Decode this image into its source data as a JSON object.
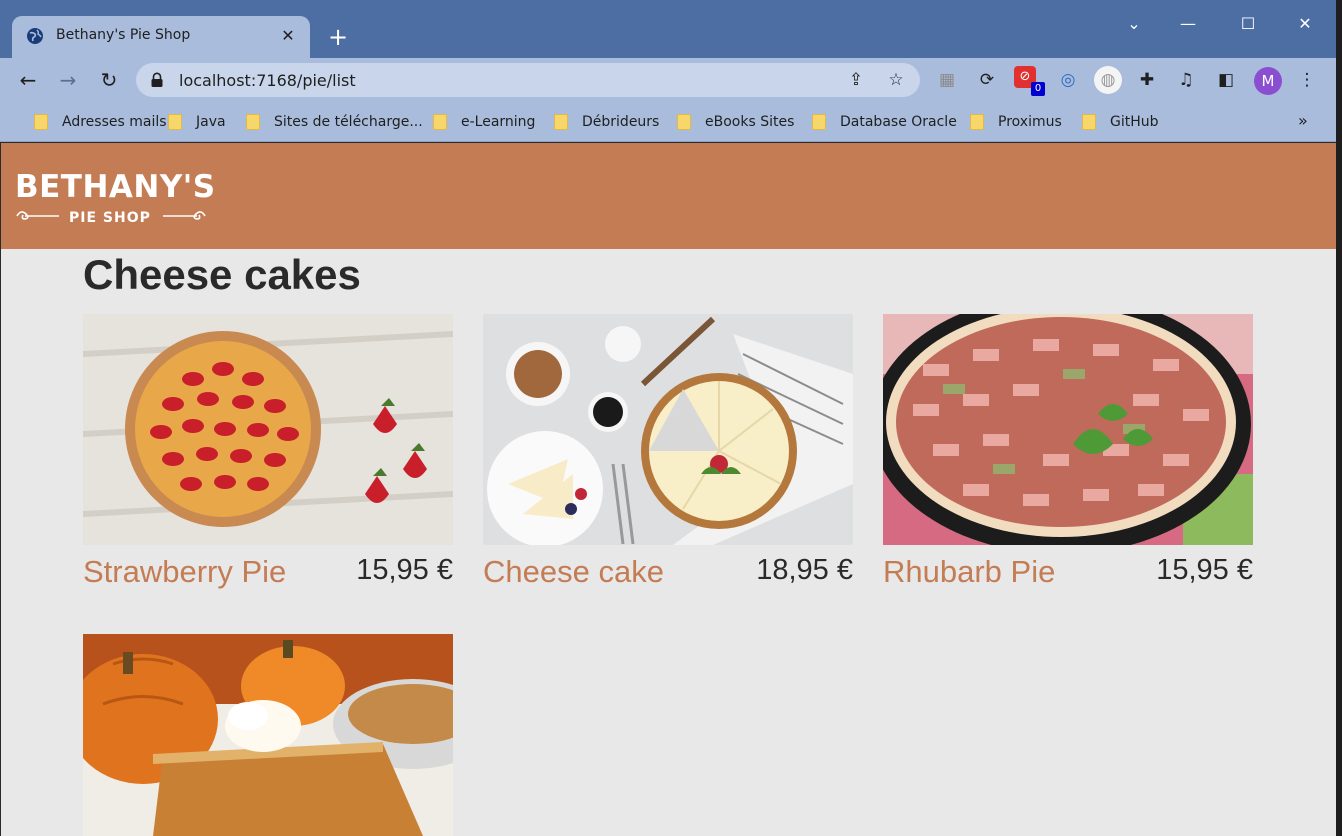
{
  "browser": {
    "tab_title": "Bethany's Pie Shop",
    "tab_close": "✕",
    "new_tab": "+",
    "url": "localhost:7168/pie/list",
    "extension_badge": "0",
    "profile_initial": "M",
    "bookmarks": [
      "Adresses mails",
      "Java",
      "Sites de télécharge...",
      "e-Learning",
      "Débrideurs",
      "eBooks Sites",
      "Database Oracle",
      "Proximus",
      "GitHub"
    ],
    "bookmarks_more": "»"
  },
  "site": {
    "logo_top": "BETHANY'S",
    "logo_bottom": "PIE SHOP",
    "brand_color": "#c47c54",
    "page_title": "Cheese cakes"
  },
  "pies": [
    {
      "name": "Strawberry Pie",
      "price": "15,95 €",
      "image": "strawberry-pie-photo"
    },
    {
      "name": "Cheese cake",
      "price": "18,95 €",
      "image": "cheese-cake-photo"
    },
    {
      "name": "Rhubarb Pie",
      "price": "15,95 €",
      "image": "rhubarb-pie-photo"
    },
    {
      "name": "",
      "price": "",
      "image": "pumpkin-pie-photo"
    }
  ]
}
